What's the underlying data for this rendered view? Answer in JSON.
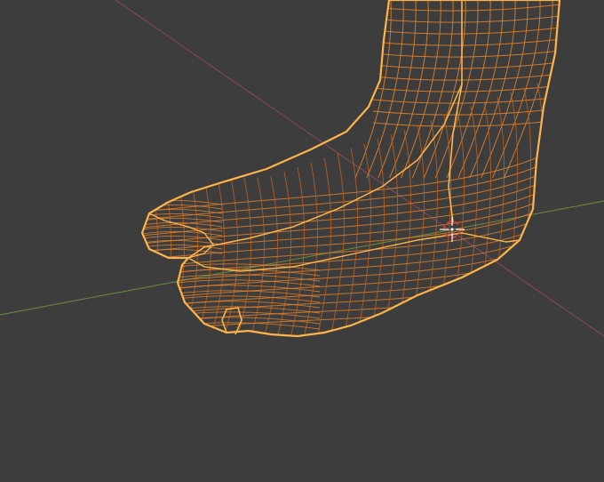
{
  "viewport": {
    "mode": "wireframe",
    "background": "#3d3d3d",
    "axes": {
      "x_axis_color": "#8a4a58",
      "y_axis_color": "#6a8e3a"
    },
    "object": {
      "name": "foot-mesh",
      "selected": true,
      "outline_color": "#ffb44a",
      "wire_color": "#e8852a",
      "wire_dark_color": "#c8641e"
    },
    "cursor_3d": {
      "outer_color": "#e23a3a",
      "inner_color": "#ffffff"
    }
  }
}
